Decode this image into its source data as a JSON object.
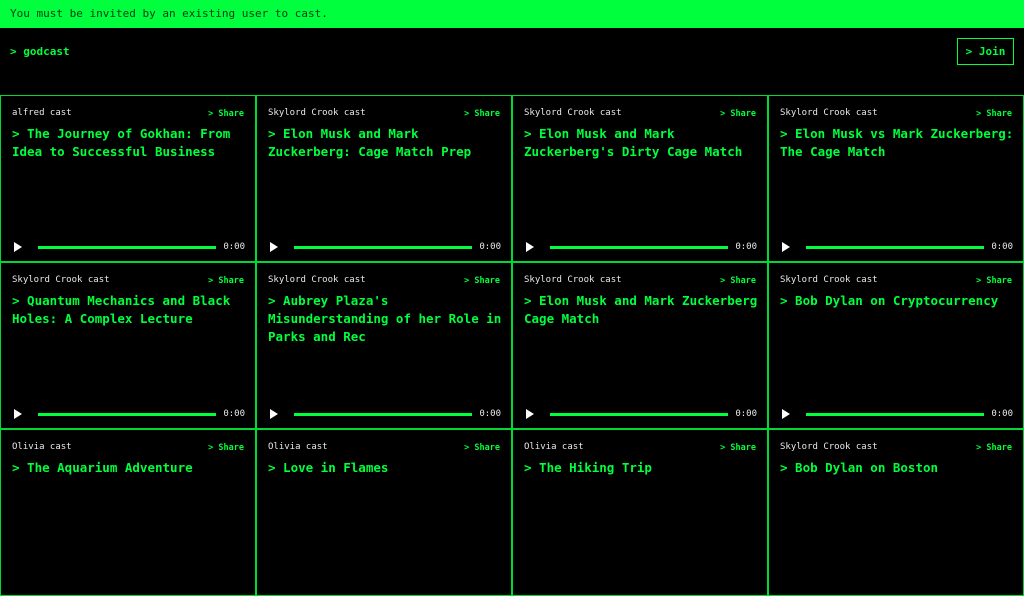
{
  "banner": {
    "text": "You must be invited by an existing user to cast."
  },
  "header": {
    "logo": "> godcast",
    "join_label": "> Join"
  },
  "card_labels": {
    "share": "> Share"
  },
  "casts": [
    {
      "author": "alfred cast",
      "title": "> The Journey of Gokhan: From Idea to Successful Business",
      "time": "0:00",
      "progress": 0
    },
    {
      "author": "Skylord Crook cast",
      "title": "> Elon Musk and Mark Zuckerberg: Cage Match Prep",
      "time": "0:00",
      "progress": 0
    },
    {
      "author": "Skylord Crook cast",
      "title": "> Elon Musk and Mark Zuckerberg's Dirty Cage Match",
      "time": "0:00",
      "progress": 0
    },
    {
      "author": "Skylord Crook cast",
      "title": "> Elon Musk vs Mark Zuckerberg: The Cage Match",
      "time": "0:00",
      "progress": 0
    },
    {
      "author": "Skylord Crook cast",
      "title": "> Quantum Mechanics and Black Holes: A Complex Lecture",
      "time": "0:00",
      "progress": 0
    },
    {
      "author": "Skylord Crook cast",
      "title": "> Aubrey Plaza's Misunderstanding of her Role in Parks and Rec",
      "time": "0:00",
      "progress": 0
    },
    {
      "author": "Skylord Crook cast",
      "title": "> Elon Musk and Mark Zuckerberg Cage Match",
      "time": "0:00",
      "progress": 0
    },
    {
      "author": "Skylord Crook cast",
      "title": "> Bob Dylan on Cryptocurrency",
      "time": "0:00",
      "progress": 0
    },
    {
      "author": "Olivia cast",
      "title": "> The Aquarium Adventure",
      "time": "",
      "progress": 0
    },
    {
      "author": "Olivia cast",
      "title": "> Love in Flames",
      "time": "",
      "progress": 0
    },
    {
      "author": "Olivia cast",
      "title": "> The Hiking Trip",
      "time": "",
      "progress": 0
    },
    {
      "author": "Skylord Crook cast",
      "title": "> Bob Dylan on Boston",
      "time": "",
      "progress": 0
    }
  ],
  "colors": {
    "accent": "#00ff3c",
    "background": "#000000",
    "text": "#e8e8e8"
  },
  "icons": {
    "player": "play-icon"
  }
}
